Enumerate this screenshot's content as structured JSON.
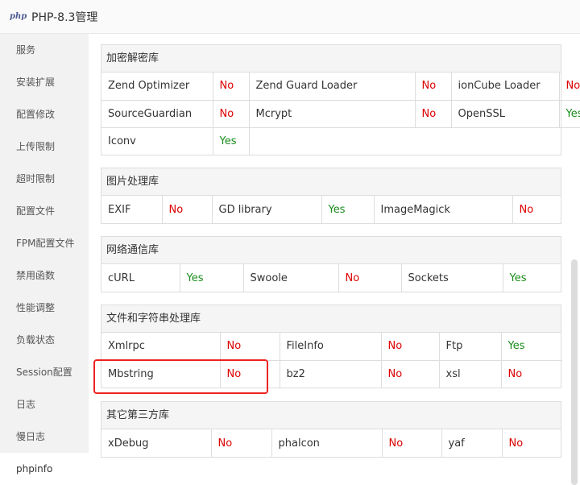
{
  "window": {
    "logo_text": "php",
    "title": "PHP-8.3管理"
  },
  "sidebar": {
    "items": [
      {
        "label": "服务"
      },
      {
        "label": "安装扩展"
      },
      {
        "label": "配置修改"
      },
      {
        "label": "上传限制"
      },
      {
        "label": "超时限制"
      },
      {
        "label": "配置文件"
      },
      {
        "label": "FPM配置文件"
      },
      {
        "label": "禁用函数"
      },
      {
        "label": "性能调整"
      },
      {
        "label": "负载状态"
      },
      {
        "label": "Session配置"
      },
      {
        "label": "日志"
      },
      {
        "label": "慢日志"
      },
      {
        "label": "phpinfo"
      }
    ],
    "active": "phpinfo"
  },
  "sections": {
    "crypto": {
      "title": "加密解密库",
      "rows": [
        [
          {
            "name": "Zend Optimizer",
            "status": "No"
          },
          {
            "name": "Zend Guard Loader",
            "status": "No"
          },
          {
            "name": "ionCube Loader",
            "status": "No"
          }
        ],
        [
          {
            "name": "SourceGuardian",
            "status": "No"
          },
          {
            "name": "Mcrypt",
            "status": "No"
          },
          {
            "name": "OpenSSL",
            "status": "Yes"
          }
        ],
        [
          {
            "name": "Iconv",
            "status": "Yes"
          }
        ]
      ]
    },
    "image": {
      "title": "图片处理库",
      "rows": [
        [
          {
            "name": "EXIF",
            "status": "No"
          },
          {
            "name": "GD library",
            "status": "Yes"
          },
          {
            "name": "ImageMagick",
            "status": "No"
          }
        ]
      ]
    },
    "network": {
      "title": "网络通信库",
      "rows": [
        [
          {
            "name": "cURL",
            "status": "Yes"
          },
          {
            "name": "Swoole",
            "status": "No"
          },
          {
            "name": "Sockets",
            "status": "Yes"
          }
        ]
      ]
    },
    "text": {
      "title": "文件和字符串处理库",
      "rows": [
        [
          {
            "name": "Xmlrpc",
            "status": "No"
          },
          {
            "name": "FileInfo",
            "status": "No"
          },
          {
            "name": "Ftp",
            "status": "Yes"
          }
        ],
        [
          {
            "name": "Mbstring",
            "status": "No"
          },
          {
            "name": "bz2",
            "status": "No"
          },
          {
            "name": "xsl",
            "status": "No"
          }
        ]
      ]
    },
    "third": {
      "title": "其它第三方库",
      "rows": [
        [
          {
            "name": "xDebug",
            "status": "No"
          },
          {
            "name": "phalcon",
            "status": "No"
          },
          {
            "name": "yaf",
            "status": "No"
          }
        ]
      ]
    }
  },
  "colors": {
    "no": "#dd0000",
    "yes": "#1a8d1a",
    "highlight": "#ee2222"
  }
}
